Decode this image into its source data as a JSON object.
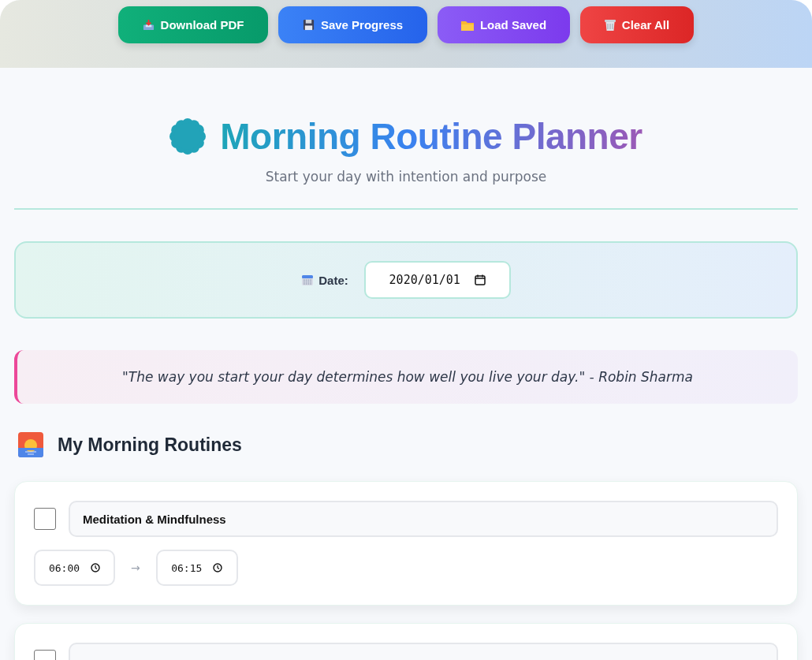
{
  "toolbar": {
    "buttons": [
      {
        "kind": "download",
        "label": "Download PDF"
      },
      {
        "kind": "save",
        "label": "Save Progress"
      },
      {
        "kind": "load",
        "label": "Load Saved"
      },
      {
        "kind": "clear",
        "label": "Clear All"
      }
    ]
  },
  "header": {
    "title": "Morning Routine Planner",
    "subtitle": "Start your day with intention and purpose"
  },
  "date": {
    "label": "Date:",
    "value": "2020/01/01"
  },
  "quote": "\"The way you start your day determines how well you live your day.\" - Robin Sharma",
  "section": {
    "title": "My Morning Routines"
  },
  "routines": [
    {
      "title": "Meditation & Mindfulness",
      "checked": false,
      "start": "06:00",
      "end": "06:15",
      "arrow": "→"
    },
    {
      "checked": false
    }
  ]
}
